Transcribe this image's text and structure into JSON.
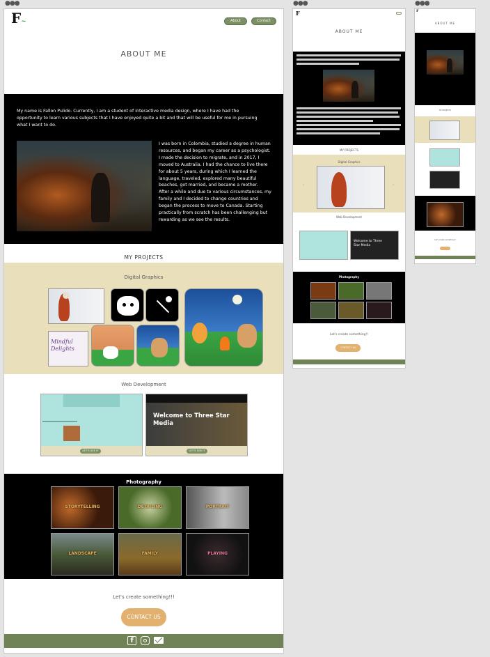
{
  "logo": {
    "letter": "F"
  },
  "nav": {
    "about_label": "About",
    "contact_label": "Contact"
  },
  "hero": {
    "title": "ABOUT ME"
  },
  "about": {
    "intro": "My name is Fallon Pulido. Currently, I am a student of interactive media design, where I have had the opportunity to learn various subjects that I have enjoyed quite a bit and that will be useful for me in pursuing what I want to do.",
    "story": "I was born in Colombia, studied a degree in human resources, and began my career as a psychologist. I made the decision to migrate, and in 2017, I moved to Australia. I had the chance to live there for about 5 years, during which I learned the language, traveled, explored many beautiful beaches, got married, and became a mother.\nAfter a while and due to various circumstances, my family and I decided to change countries and began the process to move to Canada. Starting practically from scratch has been challenging but rewarding as we see the results."
  },
  "projects": {
    "heading": "MY PROJECTS",
    "digital_graphics": "Digital Graphics",
    "web_development": "Web Development",
    "photography": "Photography",
    "web_cards": [
      {
        "banner": "",
        "button": "LET'S SEE IT"
      },
      {
        "banner": "Welcome to Three Star Media",
        "button": "LET'S SEE IT"
      }
    ],
    "dg_text": "Mindful Delights",
    "photo_tiles": [
      "STORYTELLING",
      "DETAILING",
      "PORTRAIT",
      "LANDSCAPE",
      "FAMILY",
      "PLAYING"
    ]
  },
  "cta": {
    "text": "Let's create something!!!",
    "button": "CONTACT US",
    "tablet_text": "Let's create something!!"
  },
  "footer": {
    "icons": [
      "facebook-icon",
      "instagram-icon",
      "mail-icon"
    ]
  },
  "colors": {
    "green": "#6f8357",
    "tan": "#eadfbb",
    "button": "#e2b16d",
    "black": "#000000"
  }
}
